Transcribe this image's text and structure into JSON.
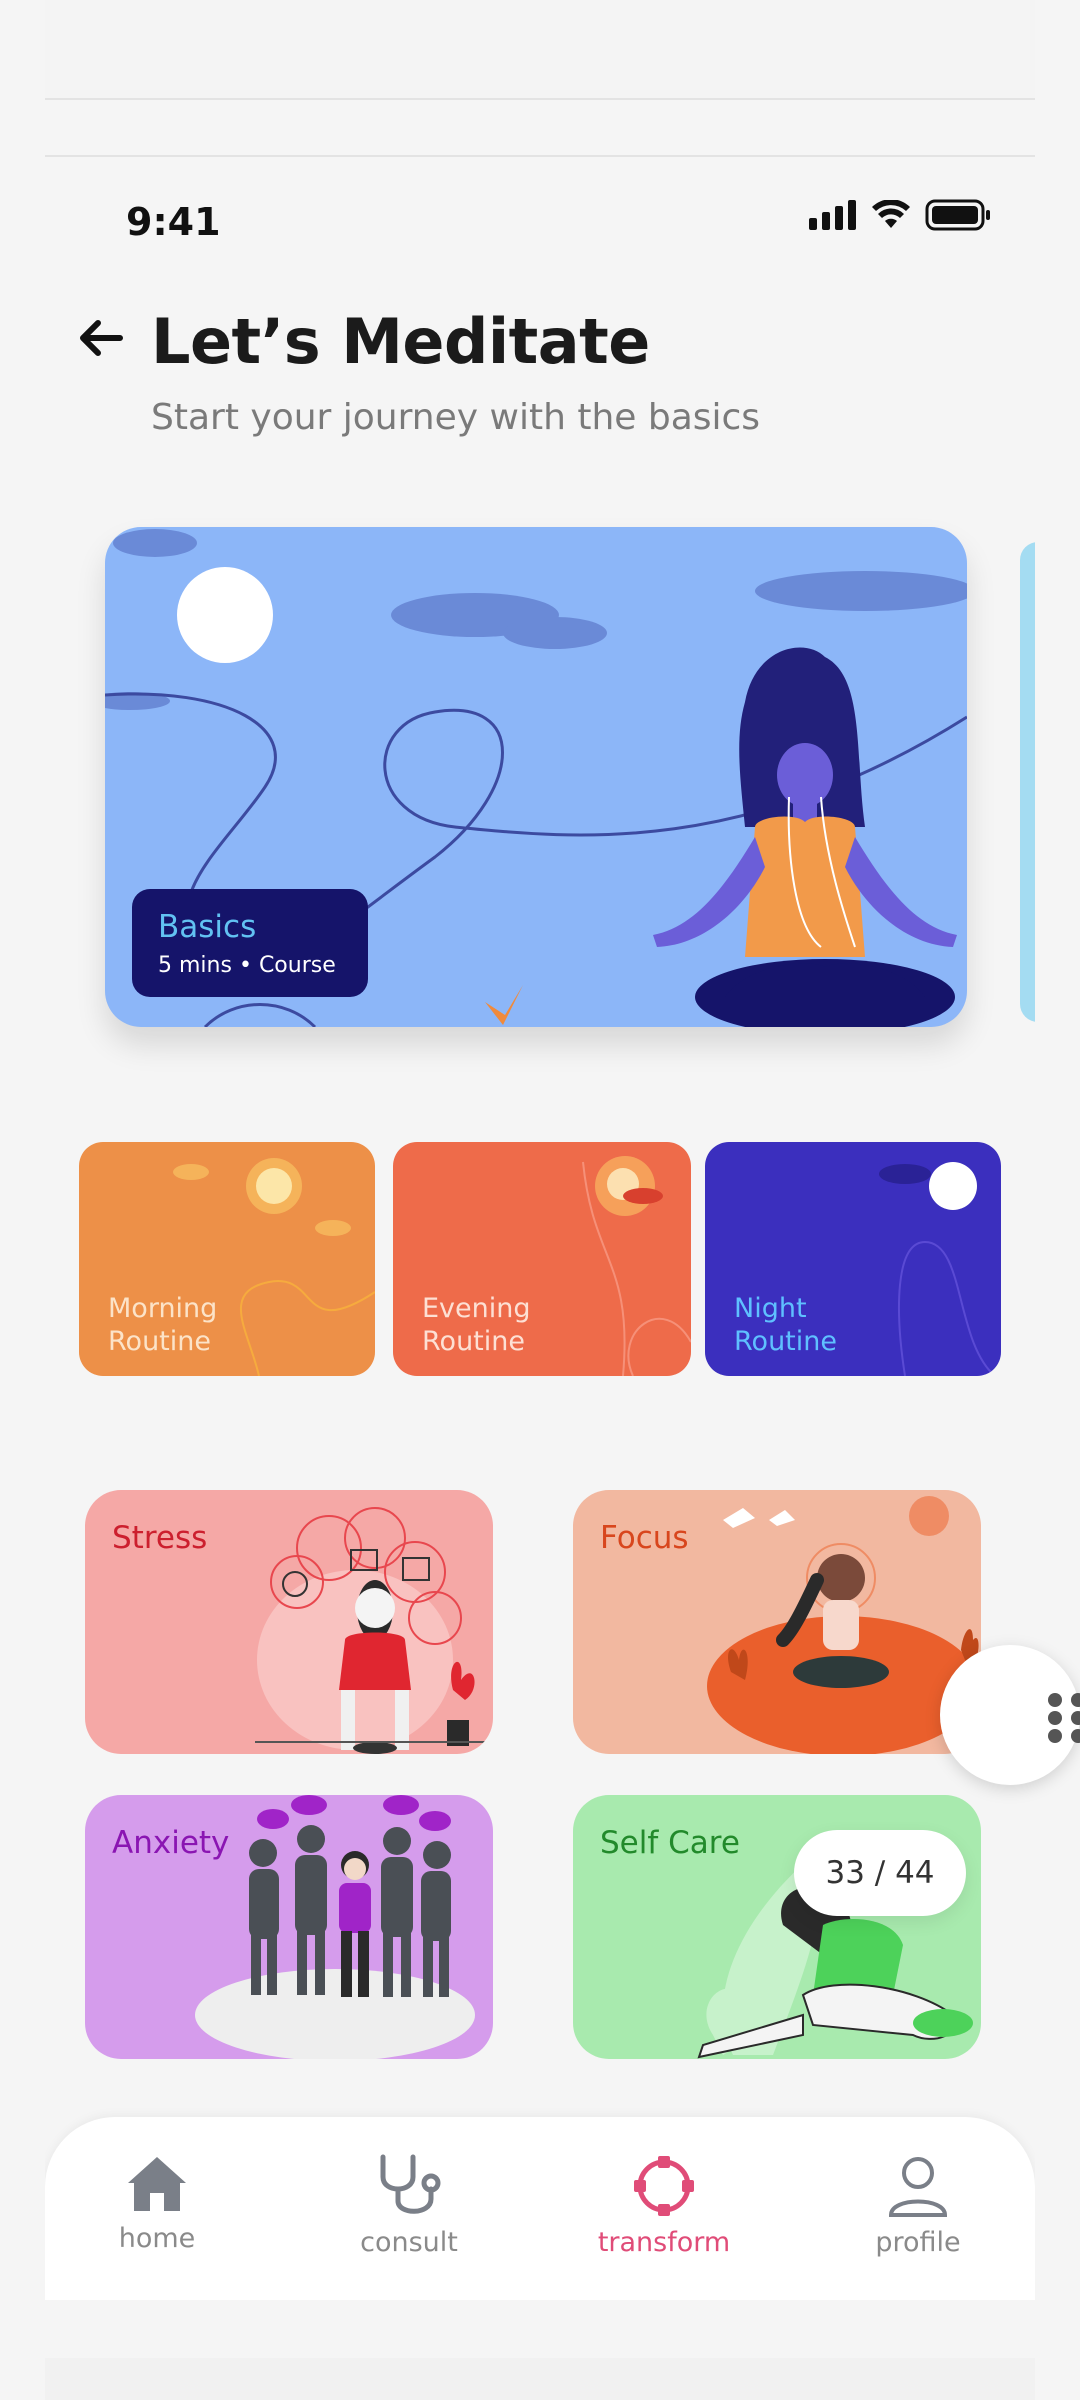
{
  "status": {
    "time": "9:41"
  },
  "header": {
    "title": "Let’s Meditate",
    "subtitle": "Start your journey with the basics"
  },
  "hero": {
    "title": "Basics",
    "duration": "5 mins",
    "type": "Course"
  },
  "routines": [
    {
      "label_line1": "Morning",
      "label_line2": "Routine",
      "bg": "#ed9048",
      "text_color": "#fce3c8"
    },
    {
      "label_line1": "Evening",
      "label_line2": "Routine",
      "bg": "#ee6b4a",
      "text_color": "#fde0d4"
    },
    {
      "label_line1": "Night",
      "label_line2": "Routine",
      "bg": "#3b2fbe",
      "text_color": "#5fc0ff"
    }
  ],
  "categories": [
    {
      "label": "Stress",
      "bg": "#f5a8a6",
      "text_color": "#cc1f2e"
    },
    {
      "label": "Focus",
      "bg": "#f2b8a0",
      "text_color": "#d8461d"
    },
    {
      "label": "Anxiety",
      "bg": "#d59cec",
      "text_color": "#8a15b2"
    },
    {
      "label": "Self Care",
      "bg": "#a8eaae",
      "text_color": "#228a2b"
    }
  ],
  "pager": {
    "counter": "33 / 44"
  },
  "nav": {
    "items": [
      {
        "label": "home",
        "icon": "home-icon"
      },
      {
        "label": "consult",
        "icon": "stethoscope-icon"
      },
      {
        "label": "transform",
        "icon": "transform-icon"
      },
      {
        "label": "profile",
        "icon": "profile-icon"
      }
    ],
    "active": "transform",
    "active_color": "#e04c78"
  }
}
